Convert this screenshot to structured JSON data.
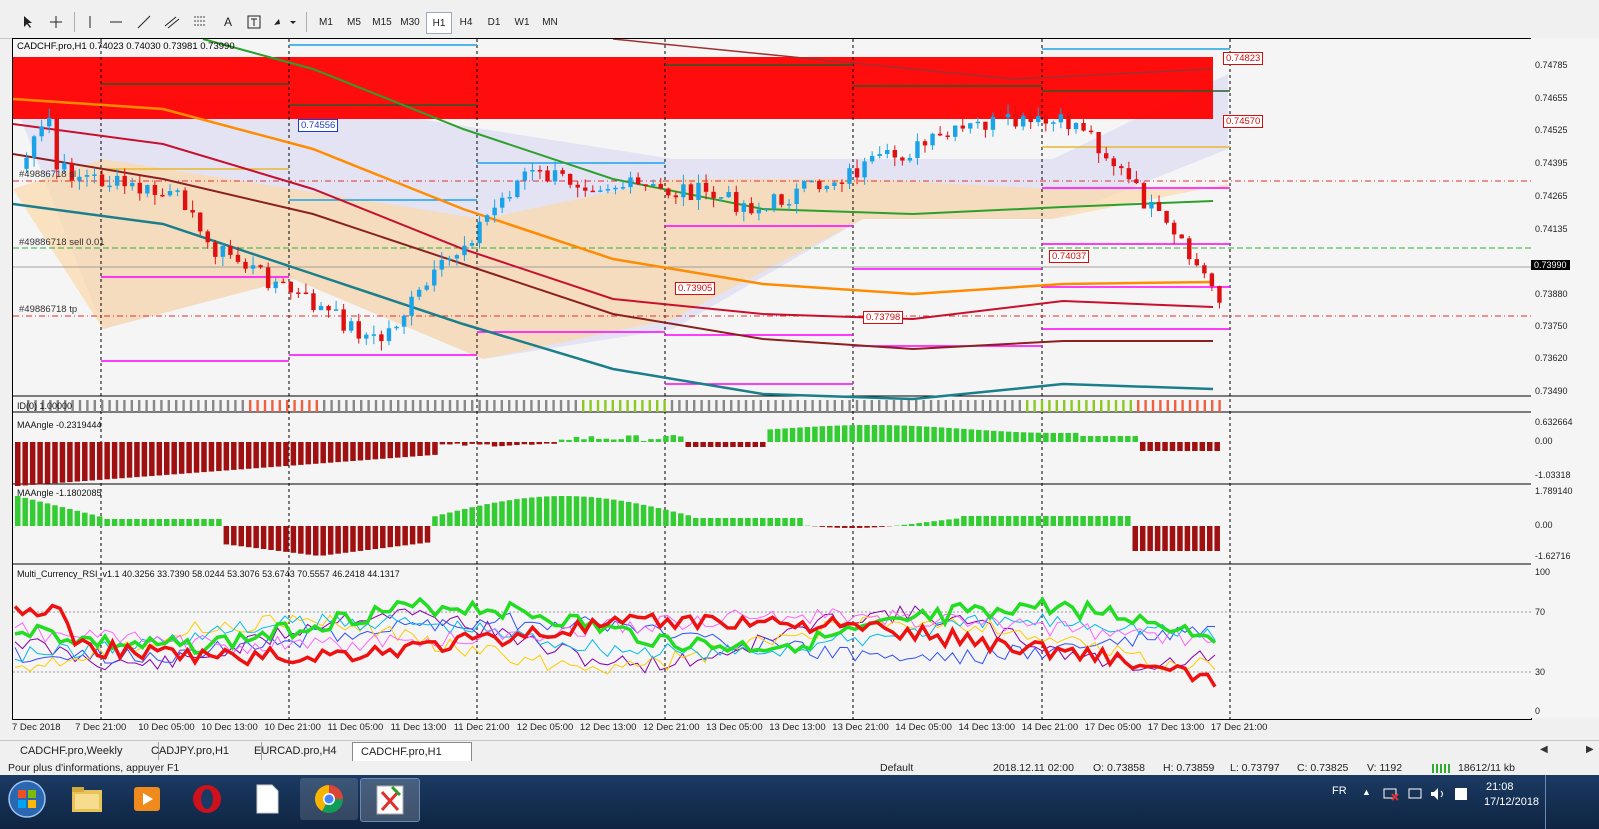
{
  "toolbar": {
    "periods": [
      "M1",
      "M5",
      "M15",
      "M30",
      "H1",
      "H4",
      "D1",
      "W1",
      "MN"
    ],
    "active_period": "H1"
  },
  "main_chart": {
    "header": "CADCHF.pro,H1  0.74023 0.74030 0.73981 0.73990",
    "overlays": {
      "level_upper": "0.74823",
      "level_mid": "0.74570",
      "level_left": "0.74556",
      "level_right": "0.74037",
      "level_low1": "0.73905",
      "level_low2": "0.73798",
      "order_sl": "#49886718 sl",
      "order_sell": "#49886718 sell 0.01",
      "order_tp": "#49886718 tp"
    },
    "price_labels": [
      "0.74785",
      "0.74655",
      "0.74525",
      "0.74395",
      "0.74265",
      "0.74135",
      "0.73990",
      "0.73880",
      "0.73750",
      "0.73620",
      "0.73490"
    ],
    "current_price": "0.73990"
  },
  "indicators": {
    "id_strip": "ID(0) 1.00000",
    "ma_angle_1": {
      "label": "MAAngle -0.2319444",
      "top": "0.632664",
      "zero": "0.00",
      "bottom": "-1.03318"
    },
    "ma_angle_2": {
      "label": "MAAngle -1.1802085",
      "top": "1.789140",
      "zero": "0.00",
      "bottom": "-1.62716"
    },
    "rsi": {
      "label": "Multi_Currency_RSI_v1.1 40.3256 33.7390 58.0244 53.3076 53.6743 70.5557 46.2418 44.1317",
      "levels": [
        "100",
        "70",
        "30",
        "0"
      ]
    }
  },
  "time_axis": [
    "7 Dec 2018",
    "7 Dec 21:00",
    "10 Dec 05:00",
    "10 Dec 13:00",
    "10 Dec 21:00",
    "11 Dec 05:00",
    "11 Dec 13:00",
    "11 Dec 21:00",
    "12 Dec 05:00",
    "12 Dec 13:00",
    "12 Dec 21:00",
    "13 Dec 05:00",
    "13 Dec 13:00",
    "13 Dec 21:00",
    "14 Dec 05:00",
    "14 Dec 13:00",
    "14 Dec 21:00",
    "17 Dec 05:00",
    "17 Dec 13:00",
    "17 Dec 21:00"
  ],
  "tabs": [
    "CADCHF.pro,Weekly",
    "CADJPY.pro,H1",
    "EURCAD.pro,H4",
    "CADCHF.pro,H1"
  ],
  "active_tab": "CADCHF.pro,H1",
  "status": {
    "help": "Pour plus d'informations, appuyer F1",
    "profile": "Default",
    "time": "2018.12.11 02:00",
    "open": "O: 0.73858",
    "high": "H: 0.73859",
    "low": "L: 0.73797",
    "close": "C: 0.73825",
    "volume": "V: 1192",
    "traffic": "18612/11 kb"
  },
  "taskbar": {
    "lang": "FR",
    "clock_time": "21:08",
    "clock_date": "17/12/2018"
  },
  "colors": {
    "bull_candle": "#1aa3e8",
    "bear_candle": "#e01010",
    "supply_zone": "#ff0000",
    "ma_green": "#2ca02c",
    "ma_orange": "#ff8c00",
    "ma_crimson": "#c8102e",
    "ma_brown": "#8b2020",
    "ma_teal": "#1a7f8a",
    "hist_green": "#33cc33",
    "hist_red": "#a01010",
    "rsi_green": "#22dd22",
    "rsi_red": "#ee1111",
    "magenta_level": "#ff00ff"
  }
}
